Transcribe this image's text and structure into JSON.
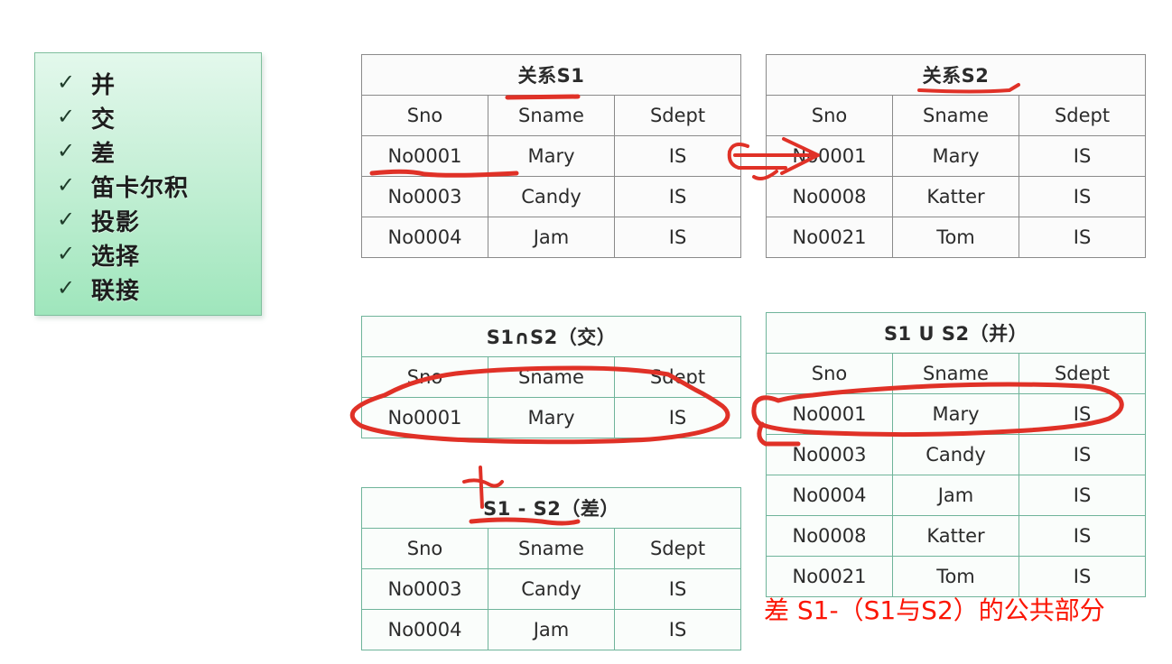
{
  "checklist": {
    "check_glyph": "✓",
    "items": [
      {
        "label": "并"
      },
      {
        "label": "交"
      },
      {
        "label": "差"
      },
      {
        "label": "笛卡尔积"
      },
      {
        "label": "投影"
      },
      {
        "label": "选择"
      },
      {
        "label": "联接"
      }
    ]
  },
  "tables": {
    "s1": {
      "title": "关系S1",
      "headers": [
        "Sno",
        "Sname",
        "Sdept"
      ],
      "rows": [
        [
          "No0001",
          "Mary",
          "IS"
        ],
        [
          "No0003",
          "Candy",
          "IS"
        ],
        [
          "No0004",
          "Jam",
          "IS"
        ]
      ]
    },
    "s2": {
      "title": "关系S2",
      "headers": [
        "Sno",
        "Sname",
        "Sdept"
      ],
      "rows": [
        [
          "No0001",
          "Mary",
          "IS"
        ],
        [
          "No0008",
          "Katter",
          "IS"
        ],
        [
          "No0021",
          "Tom",
          "IS"
        ]
      ]
    },
    "intersect": {
      "title": "S1∩S2（交）",
      "headers": [
        "Sno",
        "Sname",
        "Sdept"
      ],
      "rows": [
        [
          "No0001",
          "Mary",
          "IS"
        ]
      ]
    },
    "difference": {
      "title": "S1 - S2（差）",
      "headers": [
        "Sno",
        "Sname",
        "Sdept"
      ],
      "rows": [
        [
          "No0003",
          "Candy",
          "IS"
        ],
        [
          "No0004",
          "Jam",
          "IS"
        ]
      ]
    },
    "union": {
      "title": "S1 U S2（并）",
      "headers": [
        "Sno",
        "Sname",
        "Sdept"
      ],
      "rows": [
        [
          "No0001",
          "Mary",
          "IS"
        ],
        [
          "No0003",
          "Candy",
          "IS"
        ],
        [
          "No0004",
          "Jam",
          "IS"
        ],
        [
          "No0008",
          "Katter",
          "IS"
        ],
        [
          "No0021",
          "Tom",
          "IS"
        ]
      ]
    }
  },
  "caption": {
    "red_note": "差 S1-（S1与S2）的公共部分"
  },
  "colors": {
    "annotation_red": "#e03127",
    "caption_red": "#fb1605",
    "panel_green_top": "#e3f8ec",
    "panel_green_bottom": "#9fe6bc",
    "table_border_gray": "#8a8a8a",
    "table_border_green": "#6fb49a"
  }
}
